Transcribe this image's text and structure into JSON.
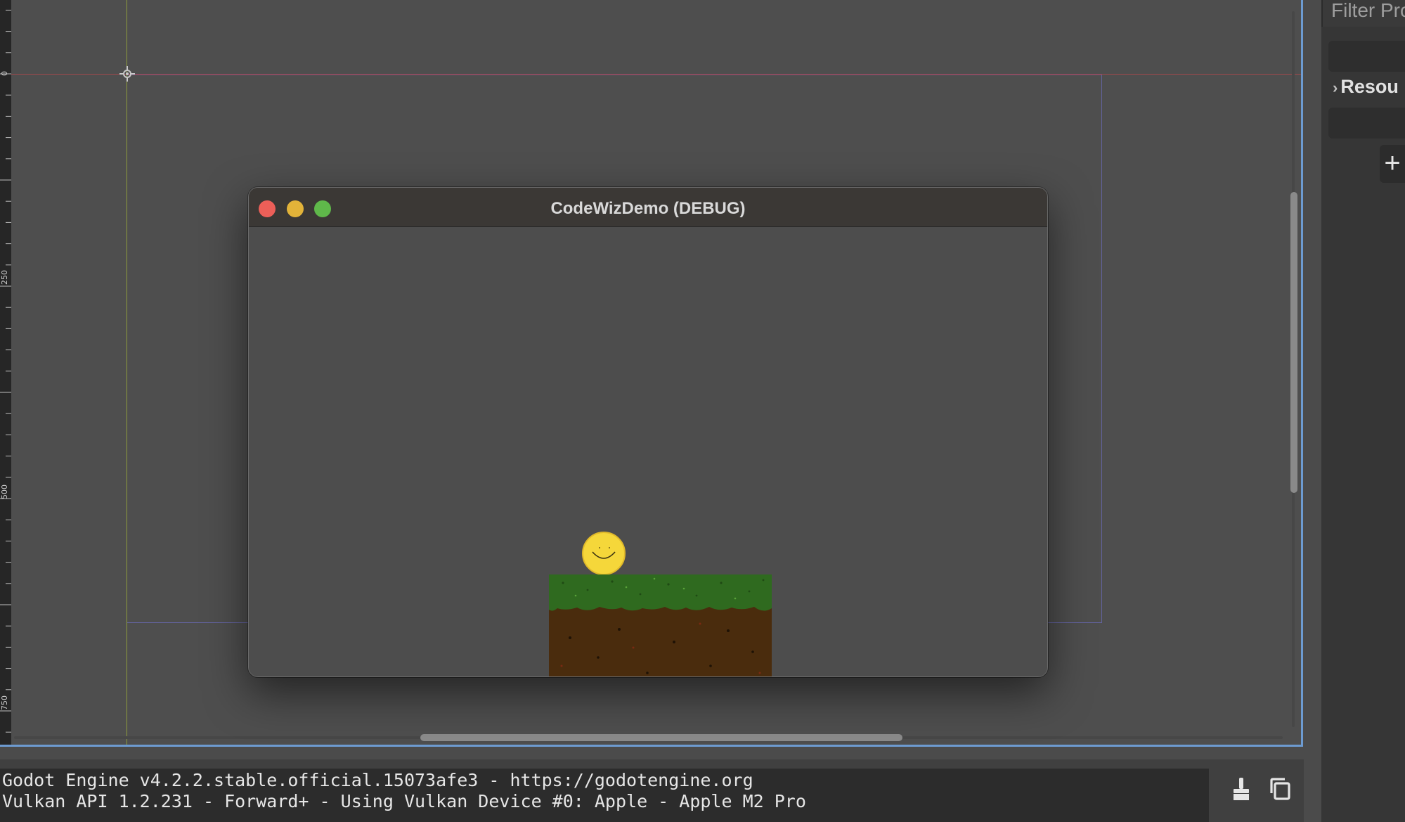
{
  "viewport": {
    "ruler_labels": [
      "0",
      "250",
      "500",
      "750"
    ]
  },
  "game_window": {
    "title": "CodeWizDemo (DEBUG)"
  },
  "right_dock": {
    "filter_placeholder": "Filter Pro",
    "resource_label": "Resou",
    "add_label": "+"
  },
  "output": {
    "lines": [
      "Godot Engine v4.2.2.stable.official.15073afe3 - https://godotengine.org",
      "Vulkan API 1.2.231 - Forward+ - Using Vulkan Device #0: Apple - Apple M2 Pro"
    ],
    "tools": [
      "clear-icon",
      "copy-icon"
    ]
  },
  "colors": {
    "viewport_border": "#6d9bd1",
    "guide_x": "#b2494d",
    "guide_y": "#9aaa3b",
    "traffic_close": "#ec5f58",
    "traffic_min": "#e2b339",
    "traffic_max": "#5fb84a"
  }
}
